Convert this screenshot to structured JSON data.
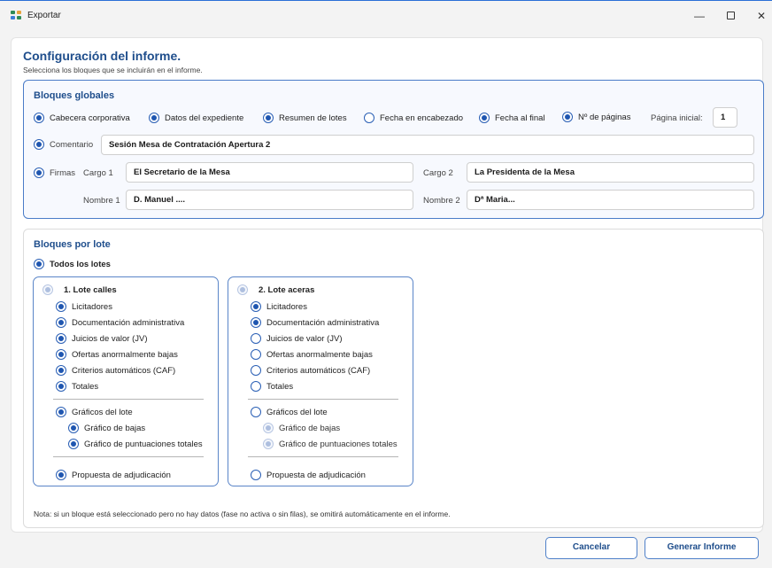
{
  "window": {
    "title": "Exportar",
    "minimize": "—",
    "close": "✕"
  },
  "header": {
    "title": "Configuración del informe.",
    "subtitle": "Selecciona los bloques que se incluirán en el informe."
  },
  "global": {
    "title": "Bloques globales",
    "options": [
      {
        "label": "Cabecera corporativa",
        "checked": true
      },
      {
        "label": "Datos del expediente",
        "checked": true
      },
      {
        "label": "Resumen de lotes",
        "checked": true
      },
      {
        "label": "Fecha en encabezado",
        "checked": false
      },
      {
        "label": "Fecha al final",
        "checked": true
      },
      {
        "label": "Nº de páginas",
        "checked": true
      }
    ],
    "pagina_inicial_label": "Página inicial:",
    "pagina_inicial_value": "1",
    "comentario_label": "Comentario",
    "comentario_checked": true,
    "comentario_value": "Sesión Mesa de Contratación Apertura 2",
    "firmas_label": "Firmas",
    "firmas_checked": true,
    "cargo1_label": "Cargo 1",
    "cargo1_value": "El Secretario de la Mesa",
    "cargo2_label": "Cargo 2",
    "cargo2_value": "La Presidenta de la Mesa",
    "nombre1_label": "Nombre 1",
    "nombre1_value": "D. Manuel ....",
    "nombre2_label": "Nombre 2",
    "nombre2_value": "Dª Maria..."
  },
  "lotes": {
    "title": "Bloques por lote",
    "todos_label": "Todos los lotes",
    "todos_checked": true,
    "cards": [
      {
        "title": "1. Lote calles",
        "items": [
          {
            "label": "Licitadores",
            "checked": true
          },
          {
            "label": "Documentación administrativa",
            "checked": true
          },
          {
            "label": "Juicios de valor (JV)",
            "checked": true
          },
          {
            "label": "Ofertas anormalmente bajas",
            "checked": true
          },
          {
            "label": "Criterios automáticos (CAF)",
            "checked": true
          },
          {
            "label": "Totales",
            "checked": true
          }
        ],
        "graficos": {
          "label": "Gráficos del lote",
          "checked": true
        },
        "sub": [
          {
            "label": "Gráfico de bajas",
            "checked": true,
            "disabled": false
          },
          {
            "label": "Gráfico de puntuaciones totales",
            "checked": true,
            "disabled": false
          }
        ],
        "propuesta": {
          "label": "Propuesta de adjudicación",
          "checked": true
        }
      },
      {
        "title": "2. Lote aceras",
        "items": [
          {
            "label": "Licitadores",
            "checked": true
          },
          {
            "label": "Documentación administrativa",
            "checked": true
          },
          {
            "label": "Juicios de valor (JV)",
            "checked": false
          },
          {
            "label": "Ofertas anormalmente bajas",
            "checked": false
          },
          {
            "label": "Criterios automáticos (CAF)",
            "checked": false
          },
          {
            "label": "Totales",
            "checked": false
          }
        ],
        "graficos": {
          "label": "Gráficos del lote",
          "checked": false
        },
        "sub": [
          {
            "label": "Gráfico de bajas",
            "checked": true,
            "disabled": true
          },
          {
            "label": "Gráfico de puntuaciones totales",
            "checked": true,
            "disabled": true
          }
        ],
        "propuesta": {
          "label": "Propuesta de adjudicación",
          "checked": false
        }
      }
    ],
    "note": "Nota: si un bloque está seleccionado pero no hay datos (fase no activa o sin filas), se omitirá automáticamente en el informe."
  },
  "footer": {
    "cancel_label": "Cancelar",
    "generate_label": "Generar Informe"
  },
  "colors": {
    "accent": "#1f4e8c",
    "radio": "#1f56b0",
    "border": "#4a7cc8"
  }
}
